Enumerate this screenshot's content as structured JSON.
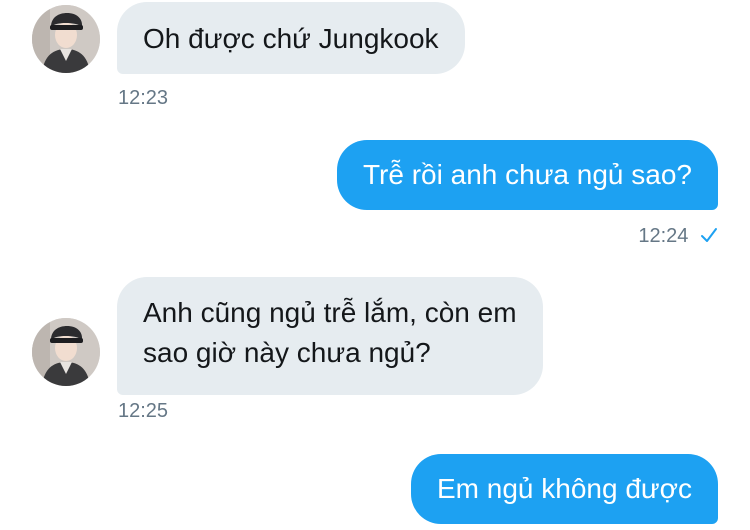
{
  "messages": [
    {
      "direction": "in",
      "text": "Oh được chứ Jungkook",
      "time": "12:23"
    },
    {
      "direction": "out",
      "text": "Trễ rồi anh chưa ngủ sao?",
      "time": "12:24",
      "status": "sent-check"
    },
    {
      "direction": "in",
      "lines": [
        "Anh cũng ngủ trễ lắm, còn em",
        "sao giờ này chưa ngủ?"
      ],
      "time": "12:25"
    },
    {
      "direction": "out",
      "text": "Em ngủ không được"
    }
  ],
  "colors": {
    "incoming_bubble": "#e6ecf0",
    "outgoing_bubble": "#1da1f2",
    "timestamp": "#657786",
    "check": "#1da1f2"
  },
  "icons": {
    "avatar": "user-avatar",
    "read_status": "check-icon"
  }
}
